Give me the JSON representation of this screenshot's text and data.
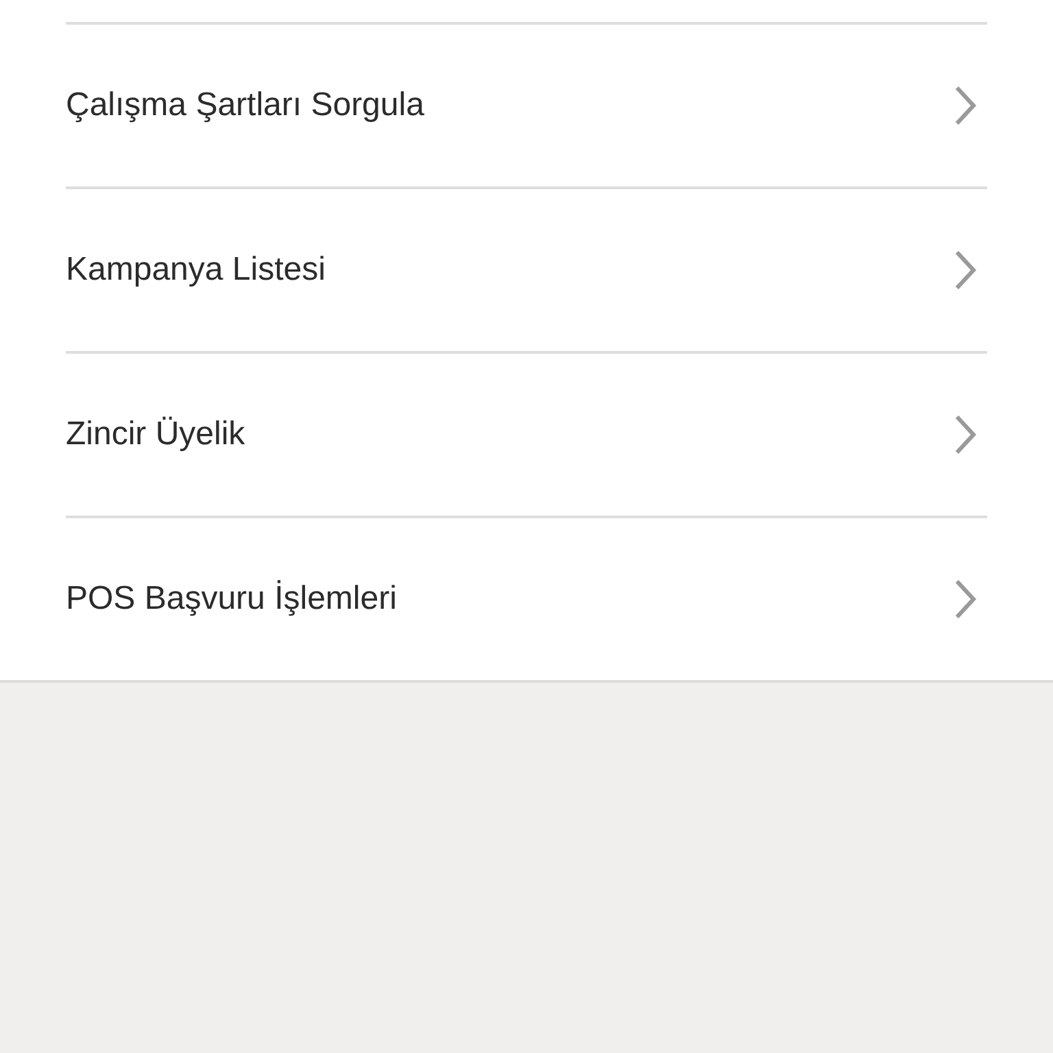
{
  "menu": {
    "items": [
      {
        "label": "Çalışma Şartları Sorgula"
      },
      {
        "label": "Kampanya Listesi"
      },
      {
        "label": "Zincir Üyelik"
      },
      {
        "label": "POS Başvuru İşlemleri"
      }
    ]
  }
}
